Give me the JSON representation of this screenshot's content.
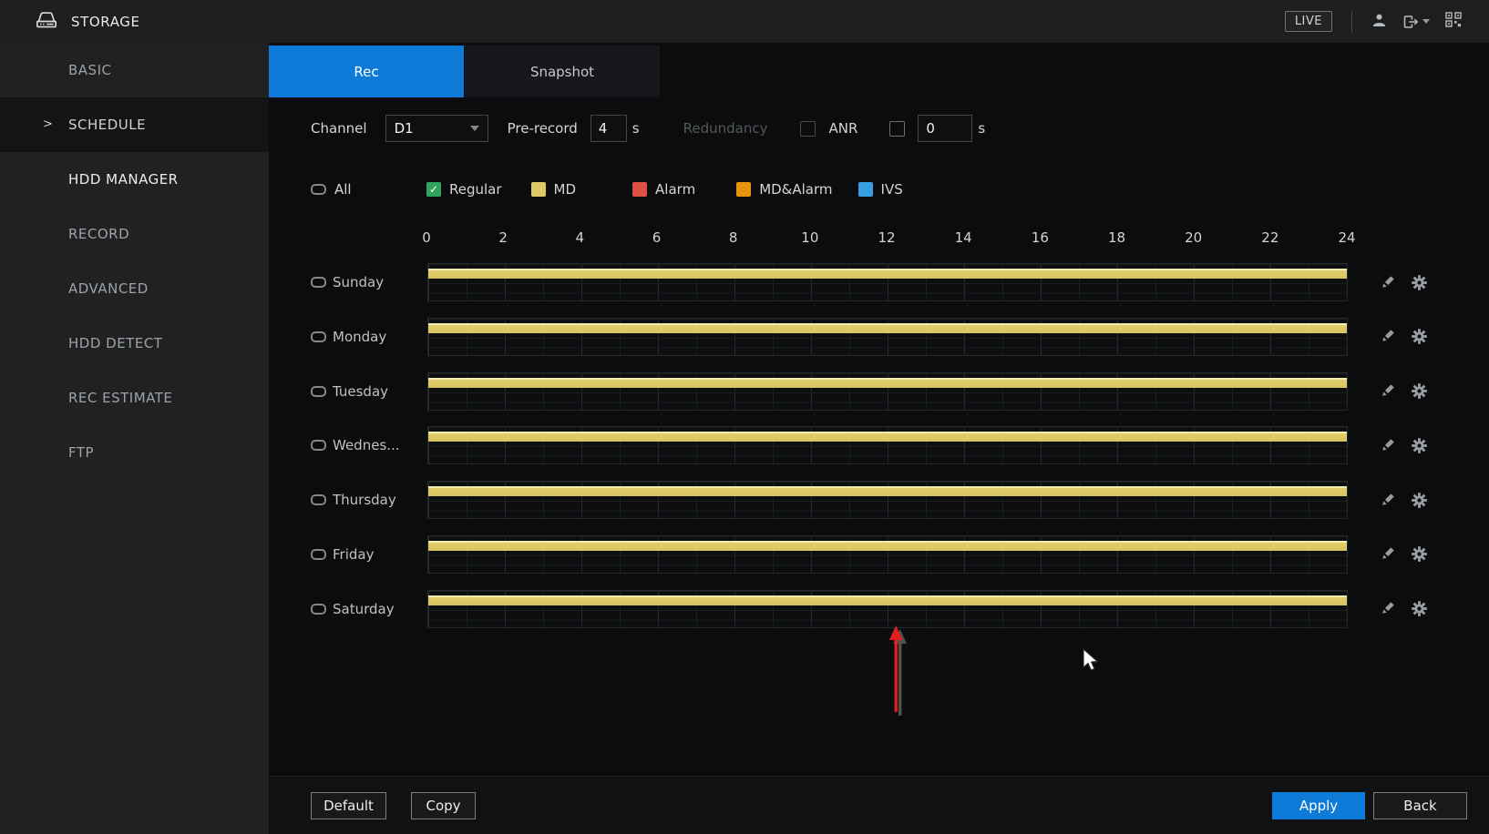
{
  "header": {
    "title": "STORAGE",
    "live_label": "LIVE"
  },
  "sidebar": {
    "items": [
      {
        "label": "BASIC"
      },
      {
        "label": "SCHEDULE",
        "selected": true
      },
      {
        "label": "HDD MANAGER",
        "emphasized": true
      },
      {
        "label": "RECORD"
      },
      {
        "label": "ADVANCED"
      },
      {
        "label": "HDD DETECT"
      },
      {
        "label": "REC ESTIMATE"
      },
      {
        "label": "FTP"
      }
    ]
  },
  "tabs": {
    "rec": "Rec",
    "snapshot": "Snapshot",
    "active": "Rec"
  },
  "controls": {
    "channel_label": "Channel",
    "channel_value": "D1",
    "prerecord_label": "Pre-record",
    "prerecord_value": "4",
    "prerecord_unit": "s",
    "redundancy_label": "Redundancy",
    "redundancy_disabled": true,
    "redundancy_checked": false,
    "anr_label": "ANR",
    "anr_checked": false,
    "anr_value": "0",
    "anr_unit": "s"
  },
  "legend": {
    "all_label": "All",
    "all_checked": false,
    "items": [
      {
        "label": "Regular",
        "color": "#2fa45f",
        "checked": true
      },
      {
        "label": "MD",
        "color": "#ddc966",
        "checked": false
      },
      {
        "label": "Alarm",
        "color": "#dd5145",
        "checked": false
      },
      {
        "label": "MD&Alarm",
        "color": "#e8930c",
        "checked": false
      },
      {
        "label": "IVS",
        "color": "#369fe0",
        "checked": false
      }
    ]
  },
  "schedule": {
    "hours": [
      "0",
      "2",
      "4",
      "6",
      "8",
      "10",
      "12",
      "14",
      "16",
      "18",
      "20",
      "22",
      "24"
    ],
    "days": [
      {
        "label": "Sunday",
        "checked": false,
        "bar": {
          "type": "MD",
          "start": 0,
          "end": 24
        }
      },
      {
        "label": "Monday",
        "checked": false,
        "bar": {
          "type": "MD",
          "start": 0,
          "end": 24
        }
      },
      {
        "label": "Tuesday",
        "checked": false,
        "bar": {
          "type": "MD",
          "start": 0,
          "end": 24
        }
      },
      {
        "label": "Wednes...",
        "checked": false,
        "bar": {
          "type": "MD",
          "start": 0,
          "end": 24
        }
      },
      {
        "label": "Thursday",
        "checked": false,
        "bar": {
          "type": "MD",
          "start": 0,
          "end": 24
        }
      },
      {
        "label": "Friday",
        "checked": false,
        "bar": {
          "type": "MD",
          "start": 0,
          "end": 24
        }
      },
      {
        "label": "Saturday",
        "checked": false,
        "bar": {
          "type": "MD",
          "start": 0,
          "end": 24
        }
      }
    ]
  },
  "footer": {
    "default_label": "Default",
    "copy_label": "Copy",
    "apply_label": "Apply",
    "back_label": "Back"
  },
  "colors": {
    "accent_blue": "#0e7bd8",
    "md_bar_yellow": "#ddc966",
    "annotation_arrow_red": "#e01f1f"
  },
  "annotations": {
    "red_arrow": "up-pointing red arrow below hour 12 of Saturday row",
    "mouse_cursor": "arrow pointer"
  }
}
